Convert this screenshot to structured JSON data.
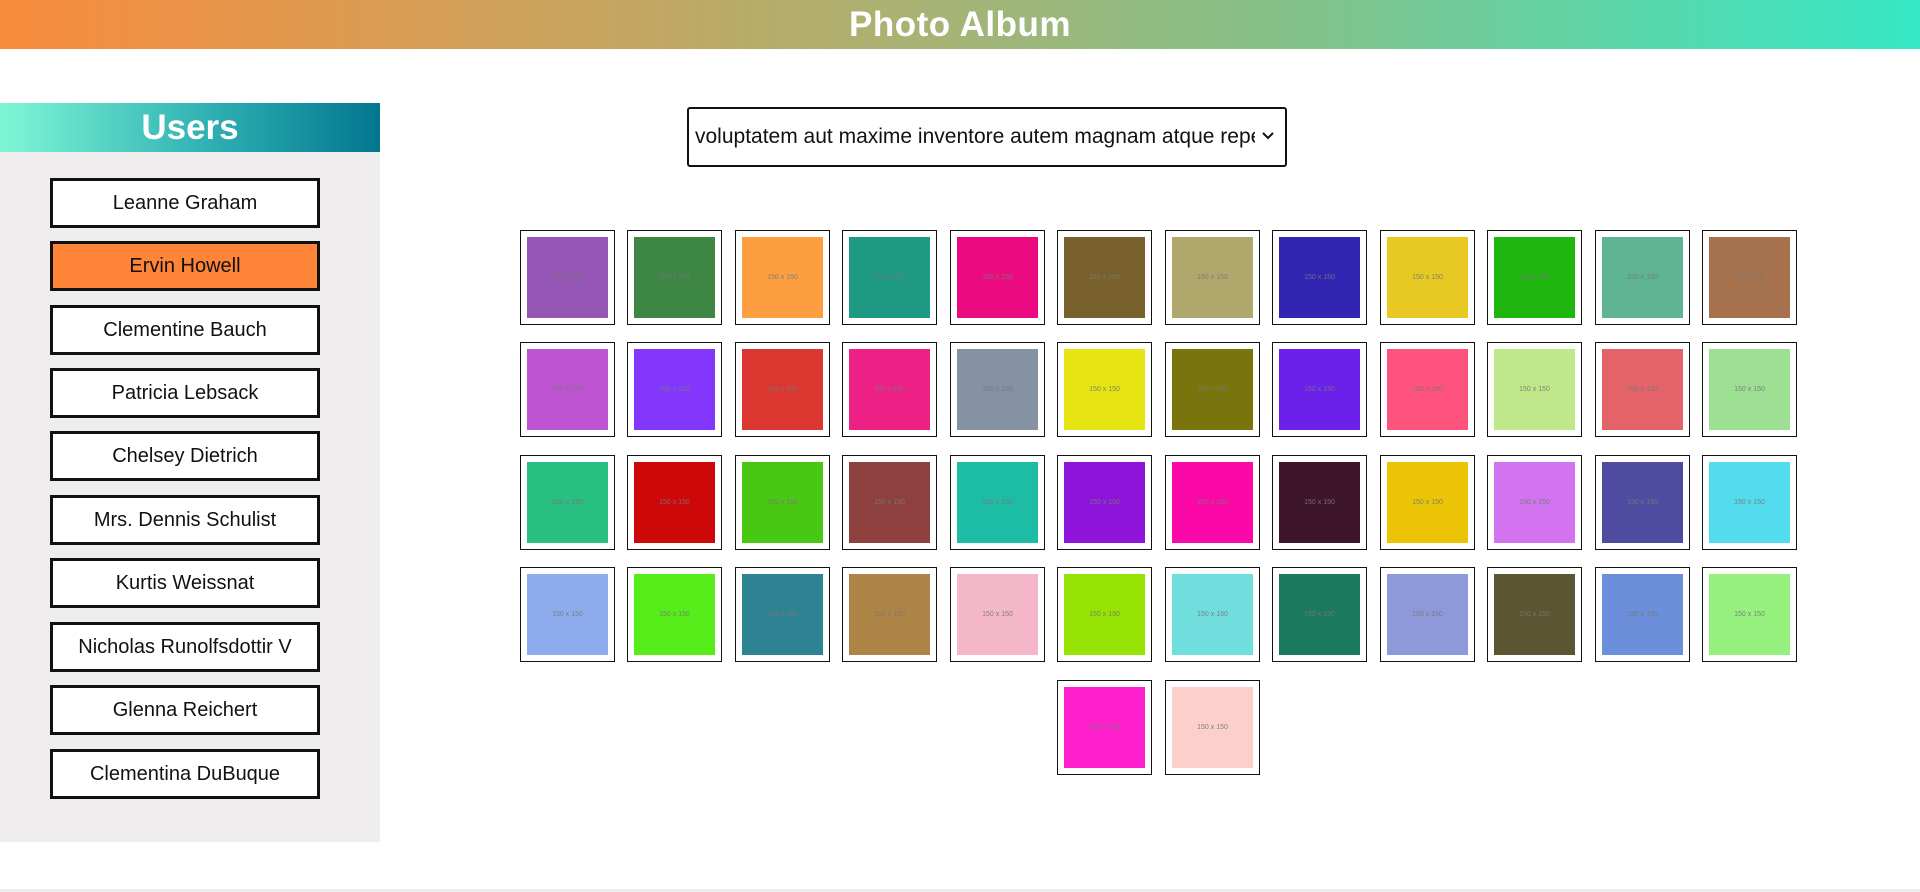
{
  "header": {
    "title": "Photo Album"
  },
  "sidebar": {
    "title": "Users",
    "active_index": 1,
    "users": [
      "Leanne Graham",
      "Ervin Howell",
      "Clementine Bauch",
      "Patricia Lebsack",
      "Chelsey Dietrich",
      "Mrs. Dennis Schulist",
      "Kurtis Weissnat",
      "Nicholas Runolfsdottir V",
      "Glenna Reichert",
      "Clementina DuBuque"
    ]
  },
  "album_select": {
    "selected": "voluptatem aut maxime inventore autem magnam atque repel"
  },
  "photos": {
    "thumb_label": "150 x 150",
    "colors": [
      "#9555b4",
      "#3e8644",
      "#fd9f40",
      "#1e9a84",
      "#ec0a81",
      "#78612d",
      "#b0a76c",
      "#3225b1",
      "#e8c822",
      "#1fb50f",
      "#5eb492",
      "#a6714d",
      "#bd53d0",
      "#8437fc",
      "#dc3630",
      "#ed2086",
      "#8592a4",
      "#e6e413",
      "#79740b",
      "#6b21e9",
      "#fe537c",
      "#bfe88a",
      "#e36369",
      "#9de094",
      "#28bf83",
      "#ce0709",
      "#48c812",
      "#8d403e",
      "#1dbda5",
      "#8e14da",
      "#fa08a8",
      "#3d162b",
      "#ebc406",
      "#d273ef",
      "#4e4ba0",
      "#53dced",
      "#8eaced",
      "#56ed1a",
      "#2e8392",
      "#ae8446",
      "#f4b7c9",
      "#97e303",
      "#71dede",
      "#1b7a5e",
      "#8e99da",
      "#5b5534",
      "#6b8fda",
      "#96f07d",
      "#fe20cd",
      "#fbcfca"
    ]
  }
}
